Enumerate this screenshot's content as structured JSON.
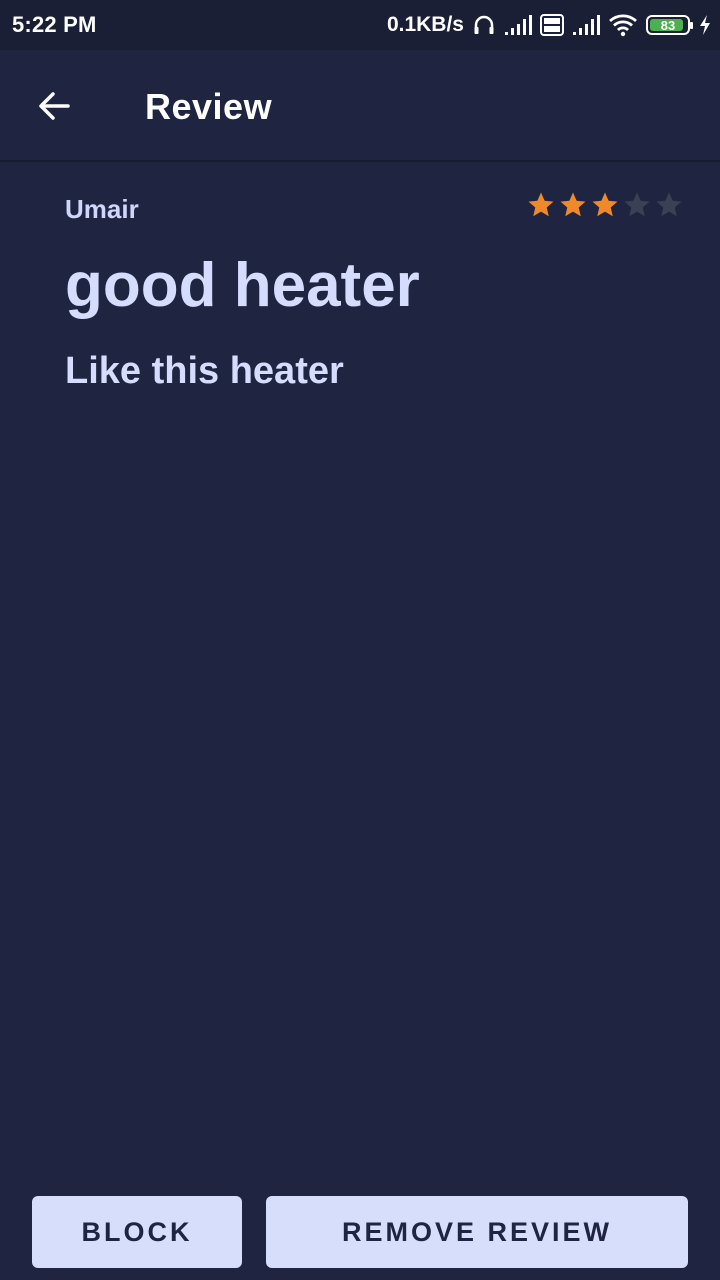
{
  "status_bar": {
    "time": "5:22 PM",
    "net_speed": "0.1KB/s",
    "battery_level": "83",
    "icons": [
      "headphones-icon",
      "signal-icon",
      "volte-icon",
      "signal-icon",
      "wifi-icon",
      "battery-icon",
      "charging-icon"
    ]
  },
  "app_bar": {
    "title": "Review",
    "back_icon": "arrow-left-icon"
  },
  "review": {
    "author": "Umair",
    "rating": 3,
    "max_rating": 5,
    "title": "good heater",
    "body": "Like this heater"
  },
  "actions": {
    "block_label": "BLOCK",
    "remove_label": "REMOVE REVIEW"
  },
  "colors": {
    "background": "#1f2540",
    "status_bar": "#1a1f35",
    "text_primary": "#d5dcfd",
    "star_filled": "#f0892a",
    "star_empty": "#3a4154",
    "button_bg": "#d7defb",
    "button_text": "#1f2540"
  }
}
